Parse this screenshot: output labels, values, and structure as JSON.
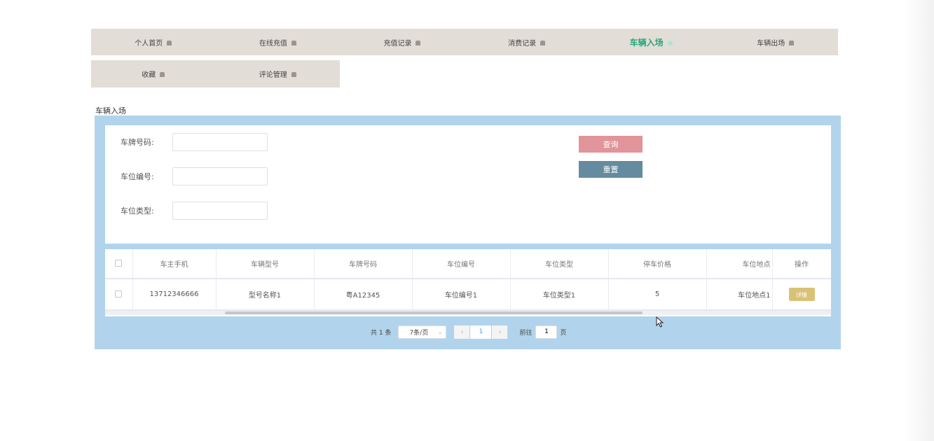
{
  "nav": {
    "row1": [
      {
        "label": "个人首页"
      },
      {
        "label": "在线充值"
      },
      {
        "label": "充值记录"
      },
      {
        "label": "消费记录"
      },
      {
        "label": "车辆入场",
        "active": true
      },
      {
        "label": "车辆出场"
      }
    ],
    "row2": [
      {
        "label": "收藏"
      },
      {
        "label": "评论管理"
      }
    ]
  },
  "page_title": "车辆入场",
  "search": {
    "plate_label": "车牌号码:",
    "plate_value": "",
    "spot_no_label": "车位编号:",
    "spot_no_value": "",
    "spot_type_label": "车位类型:",
    "spot_type_value": "",
    "query_button": "查询",
    "reset_button": "重置"
  },
  "table": {
    "headers": [
      "车主手机",
      "车辆型号",
      "车牌号码",
      "车位编号",
      "车位类型",
      "停车价格",
      "车位地点",
      "操作"
    ],
    "rows": [
      {
        "phone": "13712346666",
        "model": "型号名称1",
        "plate": "粤A12345",
        "spot_no": "车位编号1",
        "spot_type": "车位类型1",
        "price": "5",
        "location": "车位地点1",
        "action": "详情"
      }
    ]
  },
  "pagination": {
    "total": "共 1 条",
    "page_size": "7条/页",
    "prev": "‹",
    "current": "1",
    "next": "›",
    "goto_label": "前往",
    "goto_value": "1",
    "goto_unit": "页"
  },
  "colors": {
    "nav_bg": "#e2ddd6",
    "nav_active": "#2aa57c",
    "panel_bg": "#b1d4ec",
    "query_btn": "#e1949a",
    "reset_btn": "#658b9e",
    "detail_btn": "#d9c278",
    "pager_active": "#409eff"
  }
}
